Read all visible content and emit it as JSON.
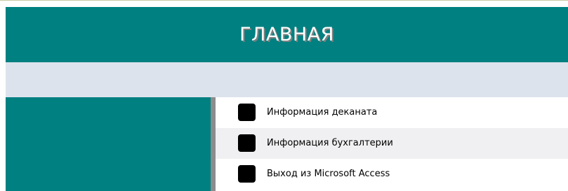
{
  "header": {
    "title": "ГЛАВНАЯ"
  },
  "menu": {
    "items": [
      {
        "label": "Информация деканата"
      },
      {
        "label": "Информация бухгалтерии"
      },
      {
        "label": "Выход из Microsoft Access"
      }
    ]
  },
  "colors": {
    "header_bg": "#008080",
    "subheader_bg": "#dde3ec",
    "sidebar_bg": "#008080",
    "button": "#000000",
    "alt_row": "#f0f0f2"
  }
}
